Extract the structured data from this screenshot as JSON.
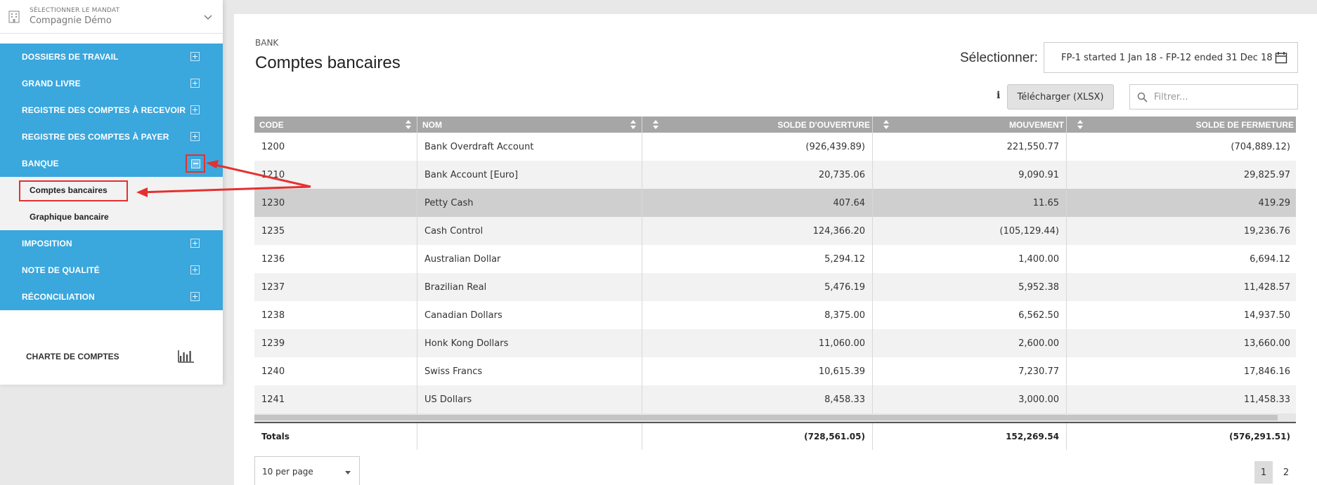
{
  "mandat": {
    "label": "SÉLECTIONNER LE MANDAT",
    "value": "Compagnie Démo"
  },
  "nav": {
    "items": [
      {
        "label": "DOSSIERS DE TRAVAIL"
      },
      {
        "label": "GRAND LIVRE"
      },
      {
        "label": "REGISTRE DES COMPTES À RECEVOIR"
      },
      {
        "label": "REGISTRE DES COMPTES À PAYER"
      },
      {
        "label": "BANQUE"
      },
      {
        "label": "IMPOSITION"
      },
      {
        "label": "NOTE DE QUALITÉ"
      },
      {
        "label": "RÉCONCILIATION"
      }
    ],
    "sub_items": [
      {
        "label": "Comptes bancaires"
      },
      {
        "label": "Graphique bancaire"
      }
    ],
    "charte": "CHARTE DE COMPTES"
  },
  "page": {
    "breadcrumb": "BANK",
    "title": "Comptes bancaires",
    "select_label": "Sélectionner:",
    "period": "FP-1 started 1 Jan 18 - FP-12 ended 31 Dec 18",
    "info": "i",
    "download_label": "Télécharger (XLSX)",
    "filter_placeholder": "Filtrer..."
  },
  "table": {
    "headers": [
      "CODE",
      "NOM",
      "SOLDE D'OUVERTURE",
      "MOUVEMENT",
      "SOLDE DE FERMETURE"
    ],
    "rows": [
      [
        "1200",
        "Bank Overdraft Account",
        "(926,439.89)",
        "221,550.77",
        "(704,889.12)"
      ],
      [
        "1210",
        "Bank Account [Euro]",
        "20,735.06",
        "9,090.91",
        "29,825.97"
      ],
      [
        "1230",
        "Petty Cash",
        "407.64",
        "11.65",
        "419.29"
      ],
      [
        "1235",
        "Cash Control",
        "124,366.20",
        "(105,129.44)",
        "19,236.76"
      ],
      [
        "1236",
        "Australian Dollar",
        "5,294.12",
        "1,400.00",
        "6,694.12"
      ],
      [
        "1237",
        "Brazilian Real",
        "5,476.19",
        "5,952.38",
        "11,428.57"
      ],
      [
        "1238",
        "Canadian Dollars",
        "8,375.00",
        "6,562.50",
        "14,937.50"
      ],
      [
        "1239",
        "Honk Kong Dollars",
        "11,060.00",
        "2,600.00",
        "13,660.00"
      ],
      [
        "1240",
        "Swiss Francs",
        "10,615.39",
        "7,230.77",
        "17,846.16"
      ],
      [
        "1241",
        "US Dollars",
        "8,458.33",
        "3,000.00",
        "11,458.33"
      ]
    ],
    "totals": {
      "label": "Totals",
      "opening": "(728,561.05)",
      "movement": "152,269.54",
      "closing": "(576,291.51)"
    }
  },
  "pagination": {
    "per_page": "10 per page",
    "pages": [
      "1",
      "2"
    ]
  },
  "colors": {
    "nav_blue": "#3aa7dd",
    "header_gray": "#a6a6a6",
    "annotation_red": "#e53030"
  }
}
